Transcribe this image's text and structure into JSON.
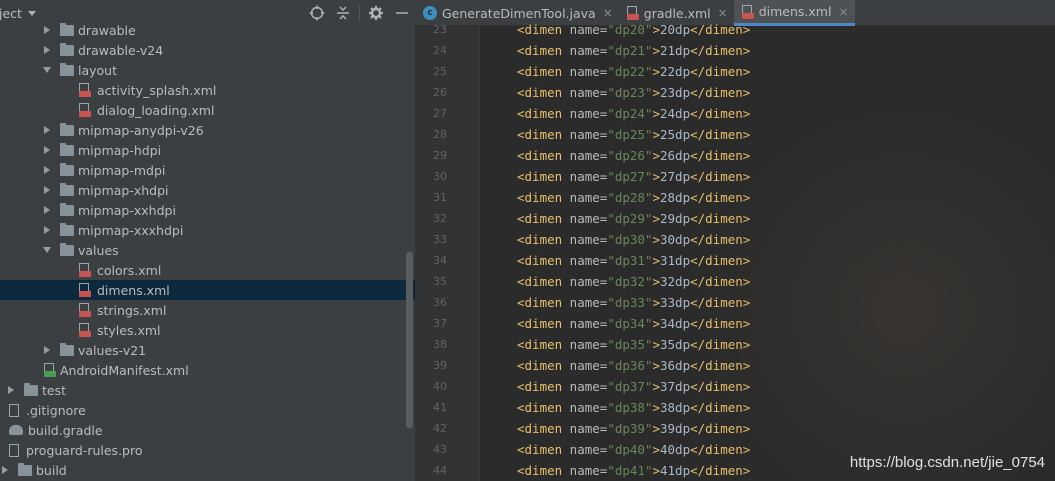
{
  "project": {
    "title": "ject",
    "tree": [
      {
        "label": "drawable",
        "type": "folder",
        "expanded": false,
        "indent": 0
      },
      {
        "label": "drawable-v24",
        "type": "folder",
        "expanded": false,
        "indent": 0
      },
      {
        "label": "layout",
        "type": "folder",
        "expanded": true,
        "indent": 0
      },
      {
        "label": "activity_splash.xml",
        "type": "xml",
        "indent": 1
      },
      {
        "label": "dialog_loading.xml",
        "type": "xml",
        "indent": 1
      },
      {
        "label": "mipmap-anydpi-v26",
        "type": "folder",
        "expanded": false,
        "indent": 0
      },
      {
        "label": "mipmap-hdpi",
        "type": "folder",
        "expanded": false,
        "indent": 0
      },
      {
        "label": "mipmap-mdpi",
        "type": "folder",
        "expanded": false,
        "indent": 0
      },
      {
        "label": "mipmap-xhdpi",
        "type": "folder",
        "expanded": false,
        "indent": 0
      },
      {
        "label": "mipmap-xxhdpi",
        "type": "folder",
        "expanded": false,
        "indent": 0
      },
      {
        "label": "mipmap-xxxhdpi",
        "type": "folder",
        "expanded": false,
        "indent": 0
      },
      {
        "label": "values",
        "type": "folder",
        "expanded": true,
        "indent": 0
      },
      {
        "label": "colors.xml",
        "type": "xml",
        "indent": 1
      },
      {
        "label": "dimens.xml",
        "type": "xml",
        "indent": 1,
        "selected": true
      },
      {
        "label": "strings.xml",
        "type": "xml",
        "indent": 1
      },
      {
        "label": "styles.xml",
        "type": "xml",
        "indent": 1
      },
      {
        "label": "values-v21",
        "type": "folder",
        "expanded": false,
        "indent": 0
      },
      {
        "label": "AndroidManifest.xml",
        "type": "manifest",
        "indent": -1
      },
      {
        "label": "test",
        "type": "folder",
        "expanded": false,
        "indent": -2
      },
      {
        "label": ".gitignore",
        "type": "file",
        "indent": -3
      },
      {
        "label": "build.gradle",
        "type": "gradle",
        "indent": -3
      },
      {
        "label": "proguard-rules.pro",
        "type": "file",
        "indent": -3
      },
      {
        "label": "build",
        "type": "folder",
        "expanded": false,
        "indent": -4
      }
    ]
  },
  "tabs": [
    {
      "label": "GenerateDimenTool.java",
      "icon": "java-class-icon",
      "active": false
    },
    {
      "label": "gradle.xml",
      "icon": "xml-file-icon",
      "active": false
    },
    {
      "label": "dimens.xml",
      "icon": "xml-file-icon",
      "active": true
    }
  ],
  "close_glyph": "×",
  "code_lines": [
    {
      "n": "23",
      "name": "dp20",
      "value": "20dp"
    },
    {
      "n": "24",
      "name": "dp21",
      "value": "21dp"
    },
    {
      "n": "25",
      "name": "dp22",
      "value": "22dp"
    },
    {
      "n": "26",
      "name": "dp23",
      "value": "23dp"
    },
    {
      "n": "27",
      "name": "dp24",
      "value": "24dp"
    },
    {
      "n": "28",
      "name": "dp25",
      "value": "25dp"
    },
    {
      "n": "29",
      "name": "dp26",
      "value": "26dp"
    },
    {
      "n": "30",
      "name": "dp27",
      "value": "27dp"
    },
    {
      "n": "31",
      "name": "dp28",
      "value": "28dp"
    },
    {
      "n": "32",
      "name": "dp29",
      "value": "29dp"
    },
    {
      "n": "33",
      "name": "dp30",
      "value": "30dp"
    },
    {
      "n": "34",
      "name": "dp31",
      "value": "31dp"
    },
    {
      "n": "35",
      "name": "dp32",
      "value": "32dp"
    },
    {
      "n": "36",
      "name": "dp33",
      "value": "33dp"
    },
    {
      "n": "37",
      "name": "dp34",
      "value": "34dp"
    },
    {
      "n": "38",
      "name": "dp35",
      "value": "35dp"
    },
    {
      "n": "39",
      "name": "dp36",
      "value": "36dp"
    },
    {
      "n": "40",
      "name": "dp37",
      "value": "37dp"
    },
    {
      "n": "41",
      "name": "dp38",
      "value": "38dp"
    },
    {
      "n": "42",
      "name": "dp39",
      "value": "39dp"
    },
    {
      "n": "43",
      "name": "dp40",
      "value": "40dp"
    },
    {
      "n": "44",
      "name": "dp41",
      "value": "41dp"
    }
  ],
  "watermark": "https://blog.csdn.net/jie_0754",
  "colors": {
    "panel_bg": "#3c3f41",
    "editor_bg": "#2b2b2b",
    "selection": "#0d293e",
    "xml_tag": "#e8bf6a",
    "xml_value": "#6a8759",
    "active_tab_underline": "#4a88c7"
  }
}
